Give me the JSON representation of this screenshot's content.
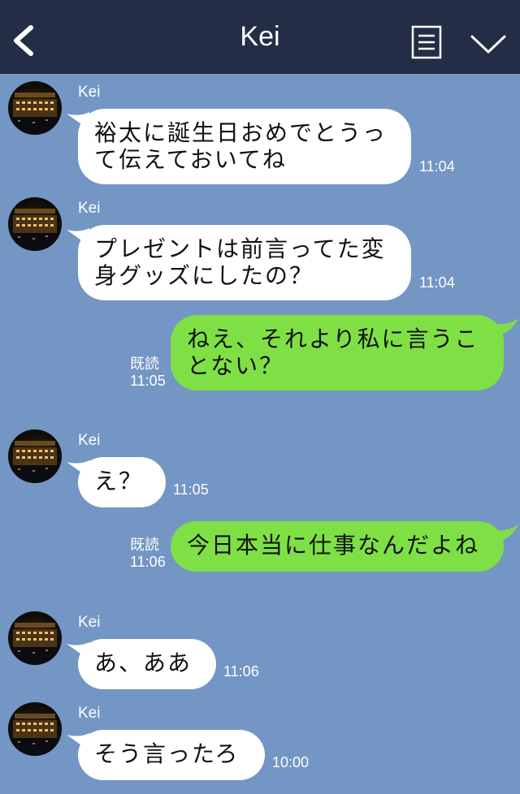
{
  "header": {
    "title": "Kei"
  },
  "messages": [
    {
      "side": "in",
      "sender": "Kei",
      "text": "裕太に誕生日おめでとうって伝えておいてね",
      "time": "11:04"
    },
    {
      "side": "in",
      "sender": "Kei",
      "text": "プレゼントは前言ってた変身グッズにしたの？",
      "time": "11:04"
    },
    {
      "side": "out",
      "read": "既読",
      "text": "ねえ、それより私に言うことない？",
      "time": "11:05"
    },
    {
      "side": "in",
      "sender": "Kei",
      "text": "え？",
      "time": "11:05"
    },
    {
      "side": "out",
      "read": "既読",
      "text": "今日本当に仕事なんだよね",
      "time": "11:06"
    },
    {
      "side": "in",
      "sender": "Kei",
      "text": "あ、ああ",
      "time": "11:06"
    },
    {
      "side": "in",
      "sender": "Kei",
      "text": "そう言ったろ",
      "time": "10:00"
    }
  ],
  "colors": {
    "background": "#7396c4",
    "header": "#232d46",
    "incoming_bubble": "#ffffff",
    "outgoing_bubble": "#7fe046"
  },
  "icons": [
    "back-arrow-icon",
    "menu-icon",
    "chevron-down-icon"
  ]
}
